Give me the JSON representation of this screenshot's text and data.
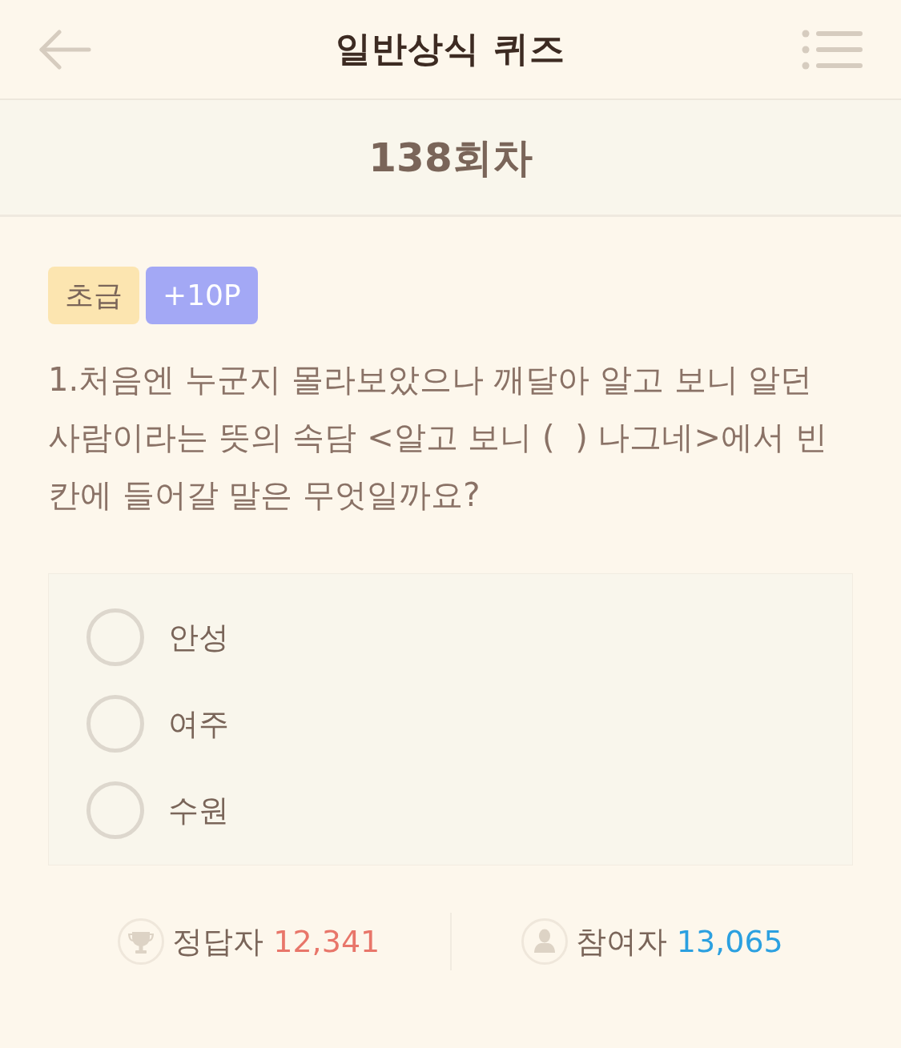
{
  "header": {
    "title": "일반상식 퀴즈"
  },
  "round": {
    "title": "138회차"
  },
  "badges": [
    {
      "kind": "level",
      "text": "초급"
    },
    {
      "kind": "points",
      "text": "+10P"
    }
  ],
  "question": "1.처음엔 누군지 몰라보았으나 깨달아 알고 보니 알던 사람이라는 뜻의 속담 <알고 보니 (  ) 나그네>에서 빈칸에 들어갈 말은 무엇일까요?",
  "options": [
    {
      "label": "안성",
      "selected": false
    },
    {
      "label": "여주",
      "selected": false
    },
    {
      "label": "수원",
      "selected": false
    }
  ],
  "stats": [
    {
      "kind": "correct",
      "label": "정답자",
      "value": "12,341"
    },
    {
      "kind": "participants",
      "label": "참여자",
      "value": "13,065"
    }
  ]
}
